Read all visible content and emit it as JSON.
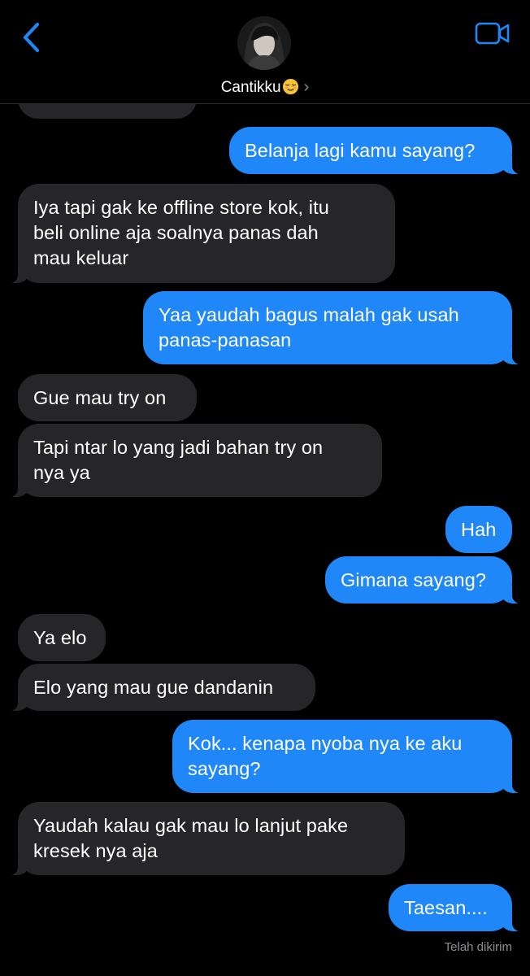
{
  "header": {
    "contact_name": "Cantikku",
    "contact_emoji": "relieved-face-emoji",
    "icons": {
      "back": "chevron-left-icon",
      "video": "video-camera-icon",
      "disclosure": "chevron-right-icon"
    },
    "accent_color": "#1f87f7"
  },
  "messages": [
    {
      "from": "them",
      "text": "Belanja lagi kamu sayang?",
      "text_alt": ""
    },
    {
      "from": "me",
      "text": "Belanja lagi kamu sayang?"
    },
    {
      "from": "them",
      "lines": [
        "Iya tapi gak ke offline store kok, itu",
        "beli online aja soalnya panas dah",
        "mau keluar"
      ]
    },
    {
      "from": "me",
      "lines": [
        "Yaa yaudah bagus malah gak usah",
        "panas-panasan"
      ]
    },
    {
      "from": "them",
      "text": "Gue mau try on"
    },
    {
      "from": "them",
      "lines": [
        "Tapi ntar lo yang jadi bahan try on",
        "nya ya"
      ]
    },
    {
      "from": "me",
      "text": "Hah"
    },
    {
      "from": "me",
      "text": "Gimana sayang?"
    },
    {
      "from": "them",
      "text": "Ya elo"
    },
    {
      "from": "them",
      "text": "Elo yang mau gue dandanin"
    },
    {
      "from": "me",
      "lines": [
        "Kok... kenapa nyoba nya ke aku",
        "sayang?"
      ]
    },
    {
      "from": "them",
      "lines": [
        "Yaudah kalau gak mau lo lanjut pake",
        "kresek nya aja"
      ]
    },
    {
      "from": "me",
      "text": "Taesan...."
    }
  ],
  "delivery_status": "Telah dikirim",
  "colors": {
    "incoming_bubble": "#262628",
    "outgoing_bubble": "#1f87f7",
    "background": "#000000",
    "status_text": "#8e8e93"
  }
}
